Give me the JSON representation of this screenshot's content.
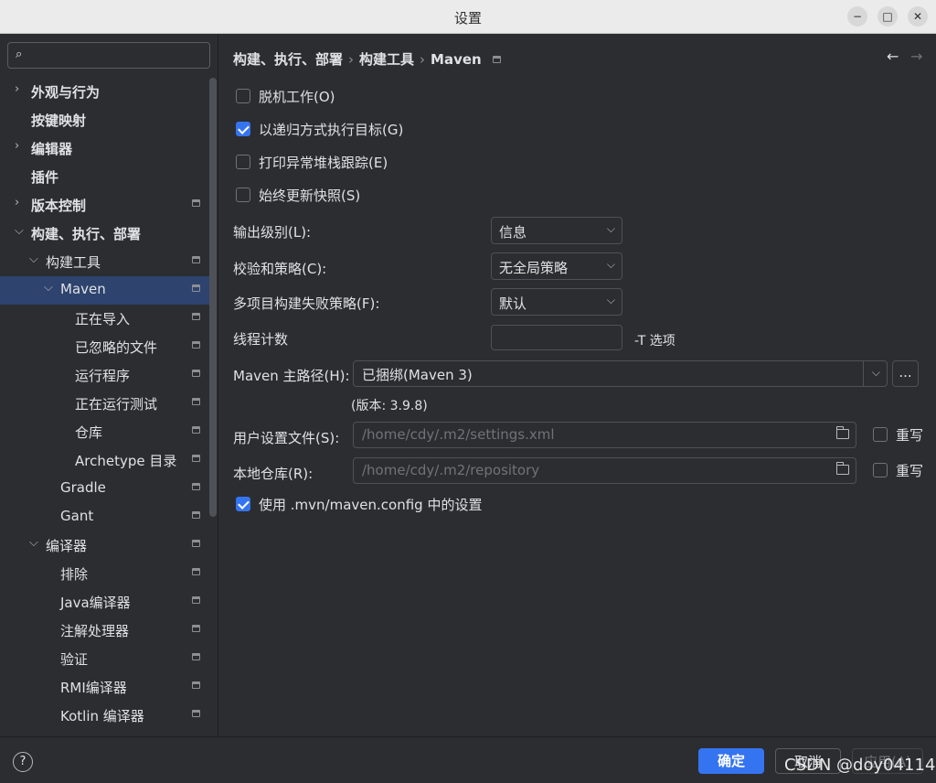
{
  "window": {
    "title": "设置",
    "minimize_glyph": "−",
    "maximize_glyph": "□",
    "close_glyph": "✕"
  },
  "sidebar": {
    "search_placeholder": "",
    "items": [
      {
        "label": "外观与行为",
        "expandable": true,
        "expanded": false,
        "bold": true,
        "pin": false
      },
      {
        "label": "按键映射",
        "expandable": false,
        "bold": true,
        "pin": false
      },
      {
        "label": "编辑器",
        "expandable": true,
        "expanded": false,
        "bold": true,
        "pin": false
      },
      {
        "label": "插件",
        "expandable": false,
        "bold": true,
        "pin": false
      },
      {
        "label": "版本控制",
        "expandable": true,
        "expanded": false,
        "bold": true,
        "pin": true
      },
      {
        "label": "构建、执行、部署",
        "expandable": true,
        "expanded": true,
        "bold": true,
        "pin": false
      },
      {
        "label": "构建工具",
        "expandable": true,
        "expanded": true,
        "bold": false,
        "pin": true
      },
      {
        "label": "Maven",
        "expandable": true,
        "expanded": true,
        "bold": false,
        "pin": true,
        "selected": true
      },
      {
        "label": "正在导入",
        "expandable": false,
        "bold": false,
        "pin": true
      },
      {
        "label": "已忽略的文件",
        "expandable": false,
        "bold": false,
        "pin": true
      },
      {
        "label": "运行程序",
        "expandable": false,
        "bold": false,
        "pin": true
      },
      {
        "label": "正在运行测试",
        "expandable": false,
        "bold": false,
        "pin": true
      },
      {
        "label": "仓库",
        "expandable": false,
        "bold": false,
        "pin": true
      },
      {
        "label": "Archetype 目录",
        "expandable": false,
        "bold": false,
        "pin": true
      },
      {
        "label": "Gradle",
        "expandable": false,
        "bold": false,
        "pin": true
      },
      {
        "label": "Gant",
        "expandable": false,
        "bold": false,
        "pin": true
      },
      {
        "label": "编译器",
        "expandable": true,
        "expanded": true,
        "bold": false,
        "pin": true
      },
      {
        "label": "排除",
        "expandable": false,
        "bold": false,
        "pin": true
      },
      {
        "label": "Java编译器",
        "expandable": false,
        "bold": false,
        "pin": true
      },
      {
        "label": "注解处理器",
        "expandable": false,
        "bold": false,
        "pin": true
      },
      {
        "label": "验证",
        "expandable": false,
        "bold": false,
        "pin": true
      },
      {
        "label": "RMI编译器",
        "expandable": false,
        "bold": false,
        "pin": true
      },
      {
        "label": "Kotlin 编译器",
        "expandable": false,
        "bold": false,
        "pin": true
      }
    ]
  },
  "breadcrumb": {
    "items": [
      "构建、执行、部署",
      "构建工具",
      "Maven"
    ],
    "separator": "›"
  },
  "nav": {
    "back": "←",
    "forward": "→"
  },
  "checkboxes": {
    "offline": {
      "label": "脱机工作(O)",
      "checked": false
    },
    "recursive": {
      "label": "以递归方式执行目标(G)",
      "checked": true
    },
    "stacktrace": {
      "label": "打印异常堆栈跟踪(E)",
      "checked": false
    },
    "always_update": {
      "label": "始终更新快照(S)",
      "checked": false
    },
    "use_mvn_config": {
      "label": "使用 .mvn/maven.config 中的设置",
      "checked": true
    }
  },
  "fields": {
    "output_level": {
      "label": "输出级别(L):",
      "value": "信息"
    },
    "checksum_policy": {
      "label": "校验和策略(C):",
      "value": "无全局策略"
    },
    "multiproject_fail": {
      "label": "多项目构建失败策略(F):",
      "value": "默认"
    },
    "thread_count": {
      "label": "线程计数",
      "value": "",
      "suffix": "-T 选项"
    },
    "maven_home": {
      "label": "Maven 主路径(H):",
      "value": "已捆绑(Maven 3)",
      "browse": "...",
      "version": "(版本: 3.9.8)"
    },
    "user_settings": {
      "label": "用户设置文件(S):",
      "value": "/home/cdy/.m2/settings.xml",
      "override_label": "重写",
      "override_checked": false
    },
    "local_repo": {
      "label": "本地仓库(R):",
      "value": "/home/cdy/.m2/repository",
      "override_label": "重写",
      "override_checked": false
    }
  },
  "footer": {
    "help": "?",
    "ok": "确定",
    "cancel": "取消",
    "apply": "应用(A)",
    "watermark": "CSDN @doy04114"
  },
  "colors": {
    "accent": "#3574f0",
    "background": "#2b2d30",
    "selection": "#2e436e",
    "text": "#dfe1e5",
    "muted": "#6f737a"
  }
}
